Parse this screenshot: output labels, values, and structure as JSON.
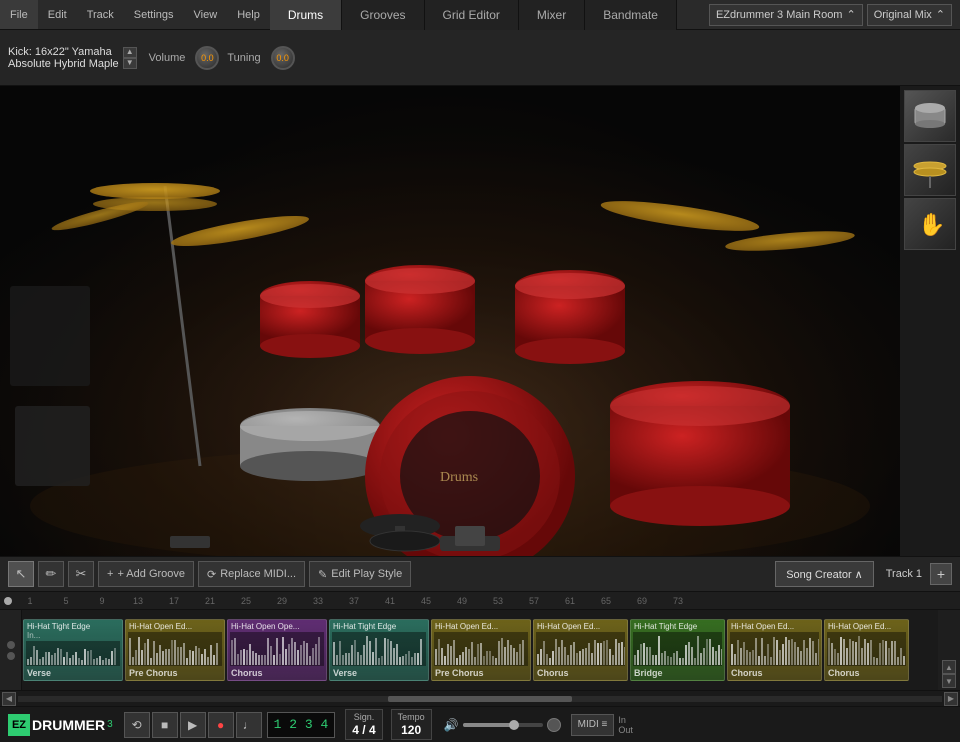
{
  "menubar": {
    "items": [
      "File",
      "Edit",
      "Track",
      "Settings",
      "View",
      "Help"
    ]
  },
  "tabs": [
    {
      "label": "Drums",
      "active": true
    },
    {
      "label": "Grooves",
      "active": false
    },
    {
      "label": "Grid Editor",
      "active": false
    },
    {
      "label": "Mixer",
      "active": false
    },
    {
      "label": "Bandmate",
      "active": false
    }
  ],
  "header": {
    "room": "EZdrummer 3 Main Room",
    "mix": "Original Mix"
  },
  "instrument": {
    "name": "Kick: 16x22\" Yamaha",
    "model": "Absolute Hybrid Maple",
    "volume_label": "Volume",
    "volume_value": "0.0",
    "tuning_label": "Tuning",
    "tuning_value": "0.0"
  },
  "toolbar": {
    "add_groove": "+ Add Groove",
    "replace_midi": "⟳ Replace MIDI...",
    "edit_play_style": "✎ Edit Play Style",
    "song_creator": "Song Creator ∧",
    "track_label": "Track 1",
    "add_track": "+"
  },
  "timeline": {
    "markers": [
      "1",
      "5",
      "9",
      "13",
      "17",
      "21",
      "25",
      "29",
      "33",
      "37",
      "41",
      "45",
      "49",
      "53",
      "57",
      "61",
      "65",
      "69",
      "73"
    ]
  },
  "tracks": [
    {
      "color": "teal",
      "label": "Hi-Hat Tight Edge",
      "name": "In...",
      "section": "Verse"
    },
    {
      "color": "yellow",
      "label": "Hi-Hat Open Ed...",
      "name": "",
      "section": "Pre Chorus"
    },
    {
      "color": "purple",
      "label": "Hi-Hat Open Ope...",
      "name": "",
      "section": "Chorus"
    },
    {
      "color": "teal",
      "label": "Hi-Hat Tight Edge",
      "name": "",
      "section": "Verse"
    },
    {
      "color": "yellow",
      "label": "Hi-Hat Open Ed...",
      "name": "",
      "section": "Pre Chorus"
    },
    {
      "color": "yellow",
      "label": "Hi-Hat Open Ed...",
      "name": "",
      "section": "Chorus"
    },
    {
      "color": "green",
      "label": "Hi-Hat Tight Edge",
      "name": "",
      "section": "Bridge"
    },
    {
      "color": "yellow",
      "label": "Hi-Hat Open Ed...",
      "name": "",
      "section": "Chorus"
    },
    {
      "color": "yellow",
      "label": "Hi-Hat Open Ed...",
      "name": "",
      "section": "Chorus"
    }
  ],
  "transport": {
    "logo_ez": "EZ",
    "logo_drummer": "DRUMMER",
    "logo_num": "3",
    "counter": "1 2 3 4",
    "sign_label": "Sign.",
    "sign_value": "4 / 4",
    "tempo_label": "Tempo",
    "tempo_value": "120"
  },
  "thumbnails": [
    {
      "name": "snare-thumb",
      "symbol": "▬"
    },
    {
      "name": "hihat-thumb",
      "symbol": "◎"
    },
    {
      "name": "hand-thumb",
      "symbol": "✋"
    }
  ],
  "block_colors": {
    "teal": "#2d7a68",
    "yellow": "#7a6e1a",
    "purple": "#6a3080",
    "green": "#3a7a22",
    "blue": "#2a4a8a"
  }
}
